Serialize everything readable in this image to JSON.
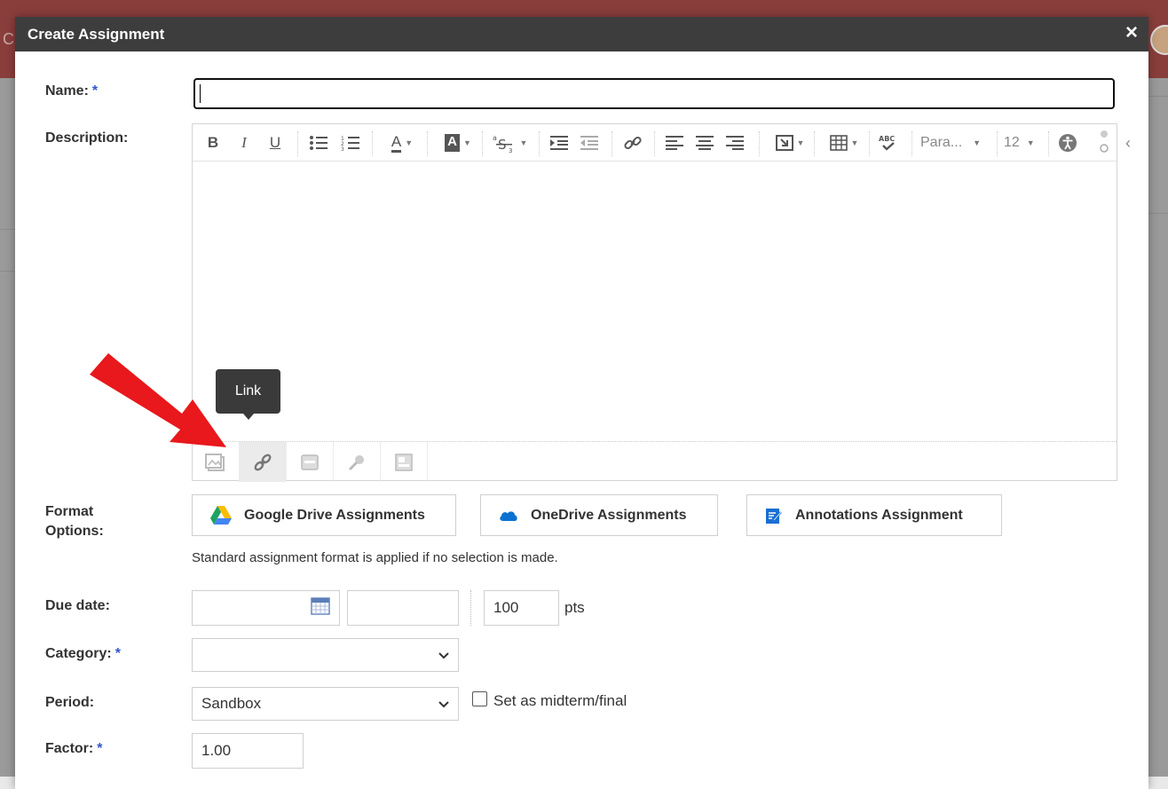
{
  "modal": {
    "title": "Create Assignment",
    "close_symbol": "×"
  },
  "form": {
    "name_label": "Name:",
    "description_label": "Description:",
    "format_label": "Format Options:",
    "due_label": "Due date:",
    "category_label": "Category:",
    "period_label": "Period:",
    "factor_label": "Factor:",
    "required_marker": "*"
  },
  "editor": {
    "toolbar": {
      "bold": "B",
      "italic": "I",
      "underline": "U",
      "font_color": "A",
      "bg_color": "A",
      "paragraph": "Para...",
      "font_size": "12"
    },
    "footer_tooltip": "Link"
  },
  "format_options": {
    "google_drive": "Google Drive Assignments",
    "onedrive": "OneDrive Assignments",
    "annotations": "Annotations Assignment",
    "hint": "Standard assignment format is applied if no selection is made."
  },
  "due": {
    "points_value": "100",
    "points_unit": "pts"
  },
  "period": {
    "value": "Sandbox",
    "midterm_label": "Set as midterm/final"
  },
  "factor": {
    "value": "1.00"
  },
  "colors": {
    "header_bg": "#3d3d3d",
    "required": "#2f55c9",
    "arrow": "#e8181c"
  }
}
